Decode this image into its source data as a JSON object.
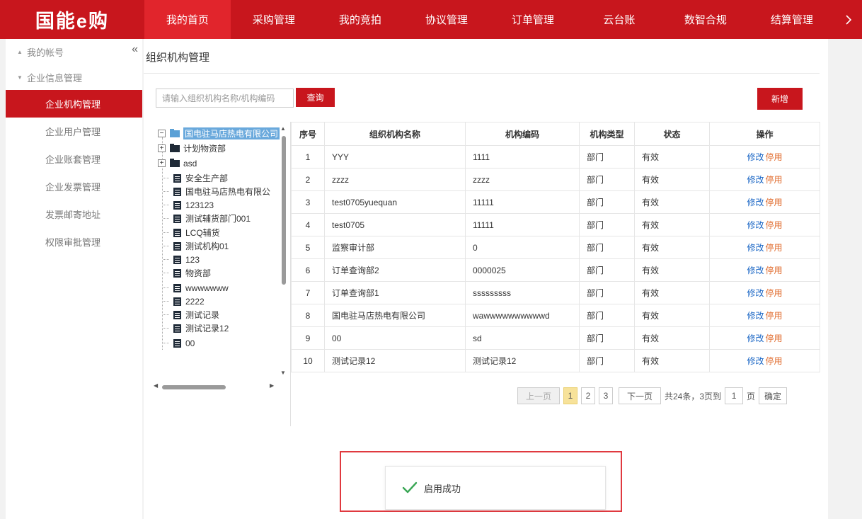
{
  "header": {
    "logo": "国能e购",
    "nav": [
      "我的首页",
      "采购管理",
      "我的竞拍",
      "协议管理",
      "订单管理",
      "云台账",
      "数智合规",
      "结算管理"
    ],
    "active_index": 0,
    "more_icon": "chevron-right-icon"
  },
  "sidebar": {
    "groups": [
      {
        "label": "我的帐号",
        "expanded": false
      },
      {
        "label": "企业信息管理",
        "expanded": true
      }
    ],
    "items": [
      "企业机构管理",
      "企业用户管理",
      "企业账套管理",
      "企业发票管理",
      "发票邮寄地址",
      "权限审批管理"
    ],
    "active_index": 0
  },
  "main": {
    "title": "组织机构管理",
    "search_placeholder": "请输入组织机构名称/机构编码",
    "query_label": "查询",
    "add_label": "新增"
  },
  "tree": {
    "root": "国电驻马店热电有限公司",
    "nodes": [
      {
        "label": "计划物资部",
        "type": "folder"
      },
      {
        "label": "asd",
        "type": "folder"
      },
      {
        "label": "安全生产部",
        "type": "leaf"
      },
      {
        "label": "国电驻马店热电有限公",
        "type": "leaf"
      },
      {
        "label": "123123",
        "type": "leaf"
      },
      {
        "label": "测试辅货部门001",
        "type": "leaf"
      },
      {
        "label": "LCQ辅货",
        "type": "leaf"
      },
      {
        "label": "测试机构01",
        "type": "leaf"
      },
      {
        "label": "123",
        "type": "leaf"
      },
      {
        "label": "物资部",
        "type": "leaf"
      },
      {
        "label": "wwwwwww",
        "type": "leaf"
      },
      {
        "label": "2222",
        "type": "leaf"
      },
      {
        "label": "测试记录",
        "type": "leaf"
      },
      {
        "label": "测试记录12",
        "type": "leaf"
      },
      {
        "label": "00",
        "type": "leaf"
      }
    ]
  },
  "table": {
    "headers": [
      "序号",
      "组织机构名称",
      "机构编码",
      "机构类型",
      "状态",
      "操作"
    ],
    "rows": [
      [
        "1",
        "YYY",
        "1111",
        "部门",
        "有效"
      ],
      [
        "2",
        "zzzz",
        "zzzz",
        "部门",
        "有效"
      ],
      [
        "3",
        "test0705yuequan",
        "11111",
        "部门",
        "有效"
      ],
      [
        "4",
        "test0705",
        "11111",
        "部门",
        "有效"
      ],
      [
        "5",
        "监察审计部",
        "0",
        "部门",
        "有效"
      ],
      [
        "6",
        "订单查询部2",
        "0000025",
        "部门",
        "有效"
      ],
      [
        "7",
        "订单查询部1",
        "sssssssss",
        "部门",
        "有效"
      ],
      [
        "8",
        "国电驻马店热电有限公司",
        "wawwwwwwwwwwd",
        "部门",
        "有效"
      ],
      [
        "9",
        "00",
        "sd",
        "部门",
        "有效"
      ],
      [
        "10",
        "测试记录12",
        "测试记录12",
        "部门",
        "有效"
      ]
    ],
    "op_edit": "修改",
    "op_stop": "停用"
  },
  "pager": {
    "prev": "上一页",
    "pages": [
      "1",
      "2",
      "3"
    ],
    "current": "1",
    "next": "下一页",
    "summary": "共24条，3页到",
    "goto_value": "1",
    "page_unit": "页",
    "confirm": "确定"
  },
  "toast": {
    "message": "启用成功",
    "icon": "check-icon"
  }
}
